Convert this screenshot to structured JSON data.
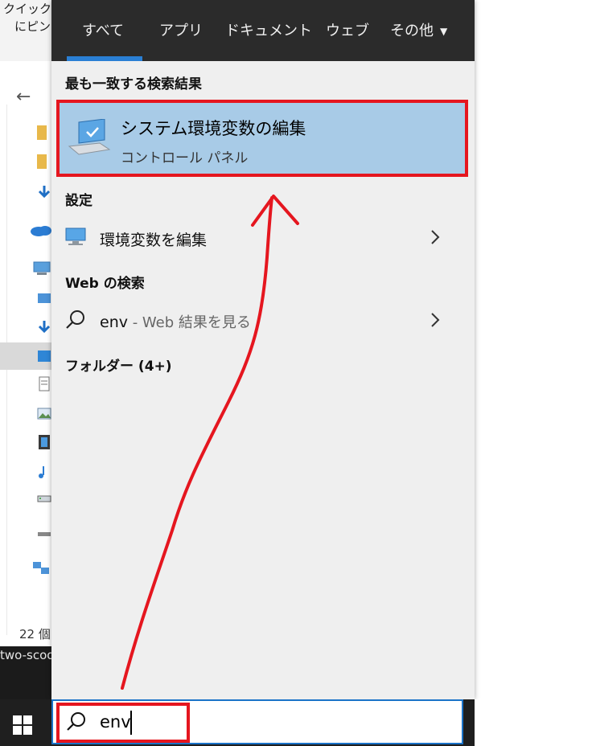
{
  "explorer": {
    "tooltip_line1": "クイック",
    "tooltip_line2": "にピン",
    "back_glyph": "←",
    "item_count": "22 個",
    "bottom_text": "two-scoo"
  },
  "tabs": [
    {
      "label": "すべて",
      "selected": true
    },
    {
      "label": "アプリ",
      "selected": false
    },
    {
      "label": "ドキュメント",
      "selected": false
    },
    {
      "label": "ウェブ",
      "selected": false
    },
    {
      "label": "その他",
      "selected": false,
      "dropdown_icon": "chevron-down-icon"
    }
  ],
  "best_match": {
    "heading": "最も一致する検索結果",
    "title": "システム環境変数の編集",
    "subtitle": "コントロール パネル",
    "icon": "monitor-check-icon",
    "highlight_color": "#e5161f"
  },
  "settings": {
    "heading": "設定",
    "item_label": "環境変数を編集",
    "icon": "monitor-icon"
  },
  "web": {
    "heading": "Web の検索",
    "query": "env",
    "suffix": " - Web 結果を見る",
    "icon": "search-icon"
  },
  "folders": {
    "heading": "フォルダー (4+)"
  },
  "search": {
    "value": "env",
    "icon": "search-icon"
  },
  "colors": {
    "accent": "#2a7fd4",
    "selection": "#a8cbe7",
    "annotation_red": "#e5161f",
    "tabbar": "#2b2b2b"
  }
}
